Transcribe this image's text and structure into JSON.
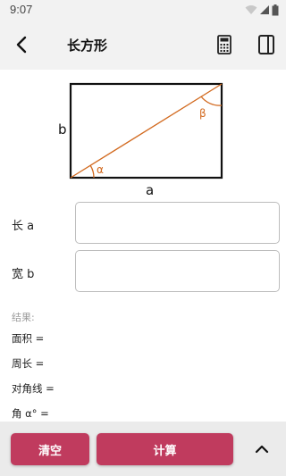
{
  "status_bar": {
    "time": "9:07",
    "icons": [
      "wifi-icon",
      "signal-icon",
      "battery-icon"
    ]
  },
  "app_bar": {
    "title": "长方形",
    "back_icon": "back-arrow-icon",
    "calc_icon": "calculator-icon",
    "panel_icon": "side-panel-icon"
  },
  "diagram": {
    "label_a": "a",
    "label_b": "b",
    "label_alpha": "α",
    "label_beta": "β",
    "accent_color": "#d2691e"
  },
  "inputs": [
    {
      "label": "长 a",
      "value": "",
      "placeholder": ""
    },
    {
      "label": "宽 b",
      "value": "",
      "placeholder": ""
    }
  ],
  "results": {
    "heading": "结果:",
    "lines": [
      "面积 =",
      "周长 =",
      "对角线 =",
      "角 α° ="
    ]
  },
  "bottom_bar": {
    "clear_label": "清空",
    "calc_label": "计算",
    "expand_icon": "chevron-up-icon"
  },
  "colors": {
    "button": "#c03b5e",
    "bar_background": "#f2f2f2"
  }
}
